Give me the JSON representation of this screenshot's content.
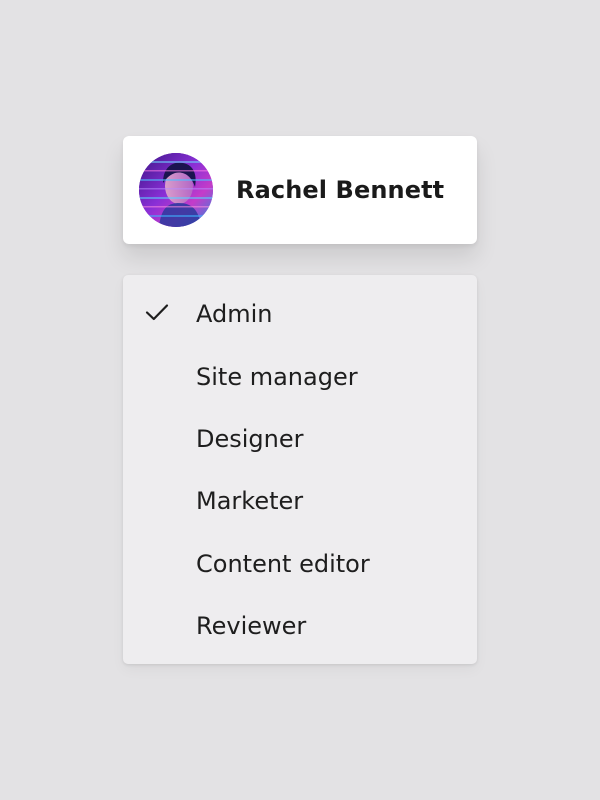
{
  "user": {
    "name": "Rachel Bennett",
    "avatar_icon": "user-avatar-photo"
  },
  "role_menu": {
    "selected": "Admin",
    "options": [
      {
        "label": "Admin",
        "checked": true
      },
      {
        "label": "Site manager",
        "checked": false
      },
      {
        "label": "Designer",
        "checked": false
      },
      {
        "label": "Marketer",
        "checked": false
      },
      {
        "label": "Content editor",
        "checked": false
      },
      {
        "label": "Reviewer",
        "checked": false
      }
    ],
    "check_icon": "checkmark-icon"
  },
  "colors": {
    "background": "#e3e2e4",
    "card": "#ffffff",
    "menu": "#eeedef",
    "text": "#1e1e1e"
  }
}
